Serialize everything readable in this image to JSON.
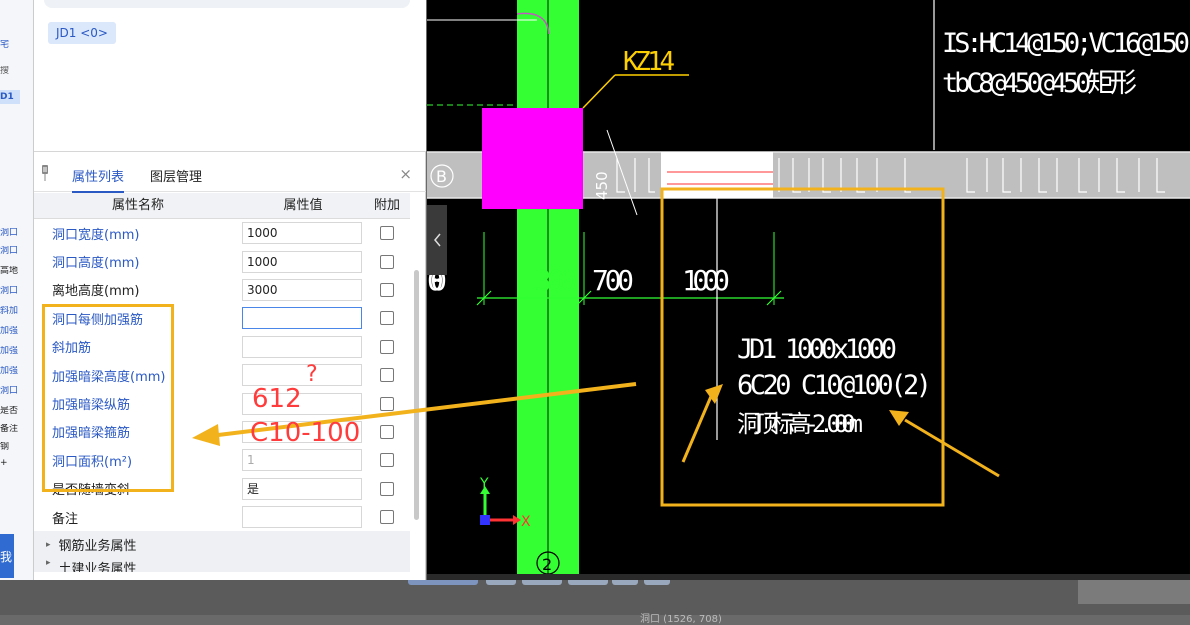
{
  "left_strip": {
    "labels": [
      "宅",
      "搜",
      "D1",
      "洞口",
      "洞口",
      "高地",
      "洞口",
      "斜加",
      "加强",
      "加强",
      "加强",
      "洞口",
      "是否",
      "备注",
      "钢",
      "+"
    ],
    "tab_char": "我"
  },
  "top": {
    "chip": "JD1 <0>"
  },
  "tabs": {
    "props": "属性列表",
    "layers": "图层管理",
    "close": "×"
  },
  "table": {
    "headers": [
      "属性名称",
      "属性值",
      "附加"
    ],
    "rows": [
      {
        "name": "洞口宽度(mm)",
        "value": "1000",
        "blue": true
      },
      {
        "name": "洞口高度(mm)",
        "value": "1000",
        "blue": true
      },
      {
        "name": "离地高度(mm)",
        "value": "3000",
        "blue": false
      },
      {
        "name": "洞口每侧加强筋",
        "value": "",
        "blue": true
      },
      {
        "name": "斜加筋",
        "value": "",
        "blue": true
      },
      {
        "name": "加强暗梁高度(mm)",
        "value": "",
        "blue": true
      },
      {
        "name": "加强暗梁纵筋",
        "value": "",
        "blue": true
      },
      {
        "name": "加强暗梁箍筋",
        "value": "",
        "blue": true
      },
      {
        "name": "洞口面积(m²)",
        "value": "1",
        "blue": true
      },
      {
        "name": "是否随墙变斜",
        "value": "是",
        "blue": false
      },
      {
        "name": "备注",
        "value": "",
        "blue": false
      }
    ],
    "sections": [
      "钢筋业务属性",
      "土建业务属性"
    ]
  },
  "annotations": {
    "line1": "612",
    "question": "?",
    "line2": "C10-100",
    "accent": "#f2b21c",
    "red": "#ff3b3b"
  },
  "cad": {
    "top_text1": "IS:HC14@150;VC16@150",
    "top_text2": "tbC8@450@450矩形",
    "column_label": "KZ14",
    "axis_b": "B",
    "axis_2": "2",
    "dim_450": "450",
    "dim_300": "300",
    "dim_700": "700",
    "dim_1000": "1000",
    "left_num": "00",
    "jd_line1": "JD1 1000x1000",
    "jd_line2": "6C20 C10@100(2)",
    "jd_line3": "洞顶标高-2.000m",
    "axis_y": "Y",
    "axis_x": "X",
    "green": "#33ff33",
    "magenta": "#ff00ff"
  },
  "status": {
    "text": "洞口 (1526, 708)"
  }
}
